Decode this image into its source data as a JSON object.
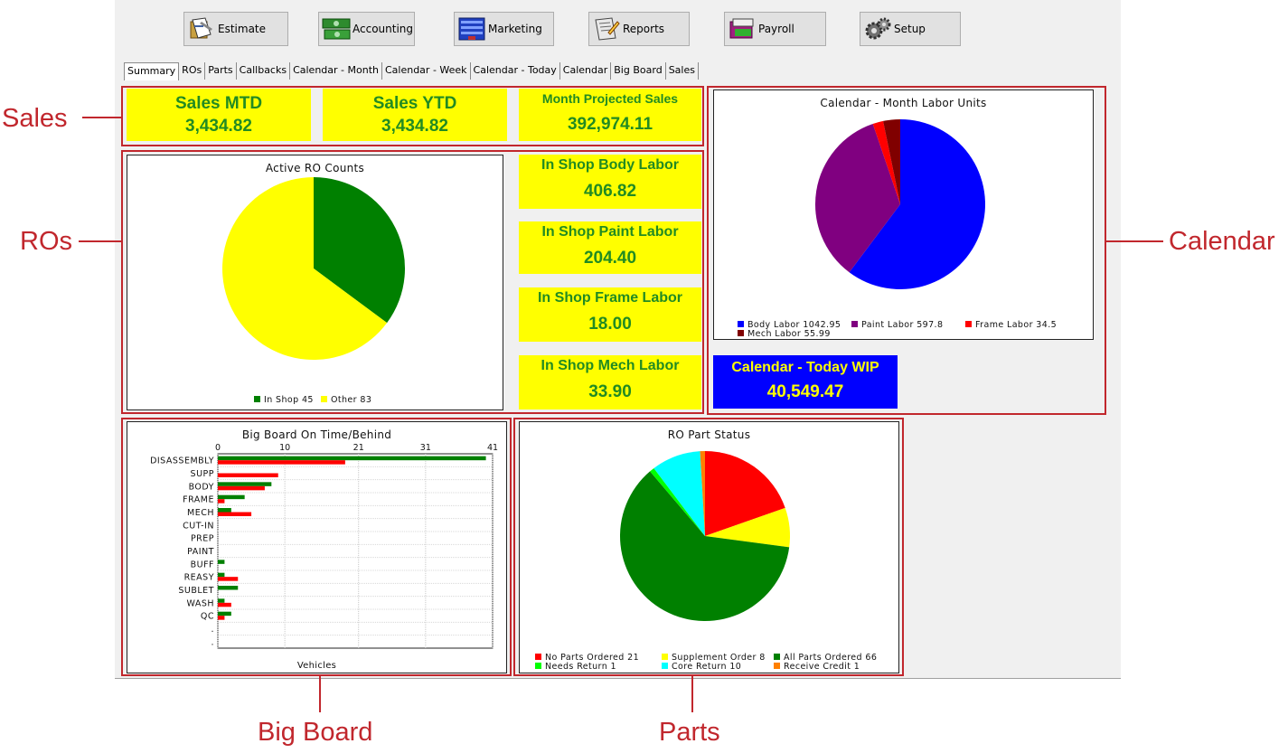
{
  "colors": {
    "highlight_yellow": "#ffff00",
    "value_green": "#228b22",
    "callout_red": "#c1272d",
    "wip_blue": "#0000ff",
    "wip_text": "#ffff00"
  },
  "toolbar": [
    {
      "label": "Estimate",
      "icon": "estimate-icon"
    },
    {
      "label": "Accounting",
      "icon": "accounting-icon"
    },
    {
      "label": "Marketing",
      "icon": "marketing-icon"
    },
    {
      "label": "Reports",
      "icon": "reports-icon"
    },
    {
      "label": "Payroll",
      "icon": "payroll-icon"
    },
    {
      "label": "Setup",
      "icon": "setup-icon"
    }
  ],
  "tabs": [
    "Summary",
    "ROs",
    "Parts",
    "Callbacks",
    "Calendar - Month",
    "Calendar - Week",
    "Calendar - Today",
    "Calendar",
    "Big Board",
    "Sales"
  ],
  "active_tab": "Summary",
  "sales": {
    "mtd": {
      "label": "Sales MTD",
      "value": "3,434.82"
    },
    "ytd": {
      "label": "Sales YTD",
      "value": "3,434.82"
    },
    "projected": {
      "label": "Month Projected Sales",
      "value": "392,974.11"
    }
  },
  "labor": {
    "body": {
      "label": "In Shop Body Labor",
      "value": "406.82"
    },
    "paint": {
      "label": "In Shop Paint Labor",
      "value": "204.40"
    },
    "frame": {
      "label": "In Shop Frame Labor",
      "value": "18.00"
    },
    "mech": {
      "label": "In Shop Mech Labor",
      "value": "33.90"
    }
  },
  "wip": {
    "label": "Calendar - Today WIP",
    "value": "40,549.47"
  },
  "callouts": {
    "sales": "Sales",
    "ros": "ROs",
    "calendar": "Calendar",
    "big_board": "Big Board",
    "parts": "Parts"
  },
  "chart_data": [
    {
      "type": "pie",
      "title": "Active RO Counts",
      "slices": [
        {
          "label": "In Shop",
          "value": 45,
          "legend": "In Shop 45",
          "color": "#008000"
        },
        {
          "label": "Other",
          "value": 83,
          "legend": "Other 83",
          "color": "#ffff00"
        }
      ]
    },
    {
      "type": "pie",
      "title": "Calendar - Month Labor Units",
      "slices": [
        {
          "label": "Body Labor",
          "value": 1042.95,
          "legend": "Body Labor 1042.95",
          "color": "#0000ff"
        },
        {
          "label": "Paint Labor",
          "value": 597.8,
          "legend": "Paint Labor 597.8",
          "color": "#800080"
        },
        {
          "label": "Frame Labor",
          "value": 34.5,
          "legend": "Frame Labor 34.5",
          "color": "#ff0000"
        },
        {
          "label": "Mech Labor",
          "value": 55.99,
          "legend": "Mech Labor 55.99",
          "color": "#800000"
        }
      ]
    },
    {
      "type": "bar",
      "orientation": "horizontal",
      "title": "Big Board On Time/Behind",
      "xlabel": "Vehicles",
      "x_ticks": [
        "0",
        "10",
        "21",
        "31",
        "41"
      ],
      "xlim": [
        0,
        41
      ],
      "grid": true,
      "categories": [
        "DISASSEMBLY",
        "SUPP",
        "BODY",
        "FRAME",
        "MECH",
        "CUT-IN",
        "PREP",
        "PAINT",
        "BUFF",
        "REASY",
        "SUBLET",
        "WASH",
        "QC",
        ".",
        "."
      ],
      "series": [
        {
          "color": "#008000",
          "values": [
            40,
            0,
            8,
            4,
            2,
            0,
            0,
            0,
            1,
            1,
            3,
            1,
            2,
            0,
            0
          ]
        },
        {
          "color": "#ff0000",
          "values": [
            19,
            9,
            7,
            1,
            5,
            0,
            0,
            0,
            0,
            3,
            0,
            2,
            1,
            0,
            0
          ]
        }
      ]
    },
    {
      "type": "pie",
      "title": "RO Part Status",
      "slices": [
        {
          "label": "No Parts Ordered",
          "value": 21,
          "legend": "No Parts Ordered 21",
          "color": "#ff0000"
        },
        {
          "label": "Supplement Order",
          "value": 8,
          "legend": "Supplement Order 8",
          "color": "#ffff00"
        },
        {
          "label": "All Parts Ordered",
          "value": 66,
          "legend": "All Parts Ordered 66",
          "color": "#008000"
        },
        {
          "label": "Needs Return",
          "value": 1,
          "legend": "Needs Return 1",
          "color": "#00ff00"
        },
        {
          "label": "Core Return",
          "value": 10,
          "legend": "Core Return 10",
          "color": "#00ffff"
        },
        {
          "label": "Receive Credit",
          "value": 1,
          "legend": "Receive Credit 1",
          "color": "#ff8000"
        }
      ]
    }
  ]
}
